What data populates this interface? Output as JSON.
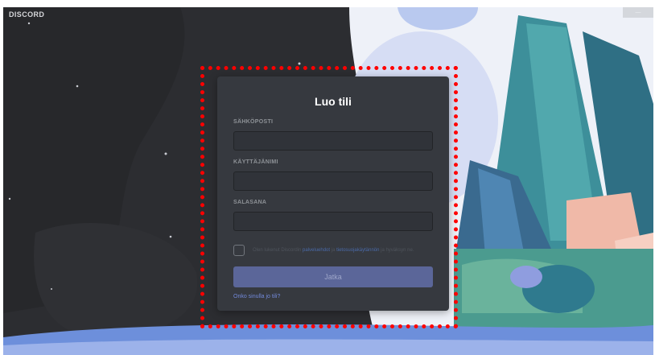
{
  "app": {
    "logo_text": "DISCORD"
  },
  "window": {
    "top_right_label": "—"
  },
  "register": {
    "title": "Luo tili",
    "email_label": "SÄHKÖPOSTI",
    "username_label": "KÄYTTÄJÄNIMI",
    "password_label": "SALASANA",
    "email_value": "",
    "username_value": "",
    "password_value": "",
    "terms_prefix": "Olen lukenut Discordin ",
    "terms_link": "palveluehdot",
    "terms_middle": " ja ",
    "privacy_link": "tietosuojakäytännön",
    "terms_suffix": " ja hyväksyn ne.",
    "submit_label": "Jatka",
    "login_link": "Onko sinulla jo tili?"
  },
  "colors": {
    "card_bg": "#36393f",
    "accent": "#7289da",
    "button_bg": "#5b6699",
    "highlight": "#ff0000"
  }
}
